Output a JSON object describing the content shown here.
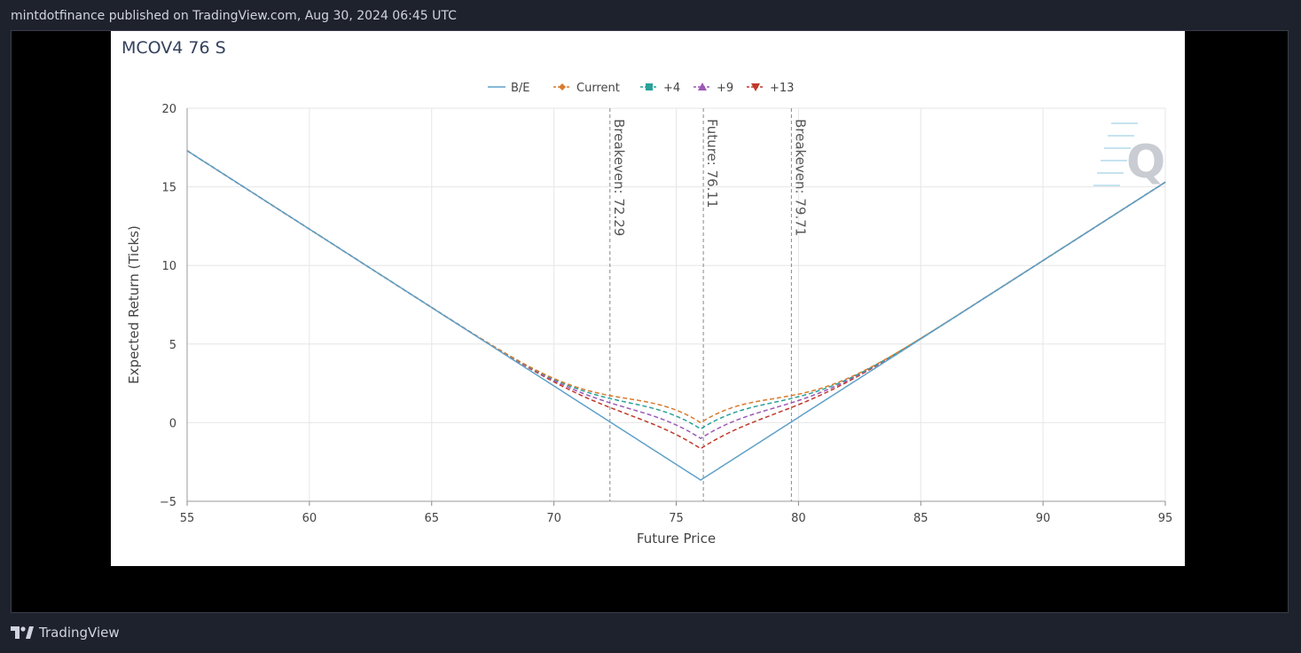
{
  "header": {
    "published_text": "mintdotfinance published on TradingView.com, Aug 30, 2024 06:45 UTC"
  },
  "footer": {
    "brand": "TradingView",
    "logo_icon": "tradingview-logo-icon"
  },
  "chart_data": {
    "type": "line",
    "title": "MCOV4 76 S",
    "xlabel": "Future Price",
    "ylabel": "Expected Return (Ticks)",
    "xlim": [
      55,
      95
    ],
    "ylim": [
      -5,
      20
    ],
    "x_ticks": [
      55,
      60,
      65,
      70,
      75,
      80,
      85,
      90,
      95
    ],
    "y_ticks": [
      20,
      15,
      10,
      5,
      0,
      -5
    ],
    "y_tick_labels": [
      "20",
      "15",
      "10",
      "5",
      "0",
      "−5"
    ],
    "grid": true,
    "legend_position": "top-center",
    "strike": 76,
    "series": [
      {
        "name": "B/E",
        "color": "#5fa0c8",
        "dash": false,
        "marker": "line",
        "min_value": -3.65
      },
      {
        "name": "Current",
        "color": "#d87a2c",
        "dash": true,
        "marker": "diamond",
        "min_value": 0.0
      },
      {
        "name": "+4",
        "color": "#2aa198",
        "dash": true,
        "marker": "square",
        "min_value": -0.4
      },
      {
        "name": "+9",
        "color": "#9b59b6",
        "dash": true,
        "marker": "triangle-up",
        "min_value": -1.0
      },
      {
        "name": "+13",
        "color": "#c0392b",
        "dash": true,
        "marker": "triangle-down",
        "min_value": -1.65
      }
    ],
    "vertical_lines": [
      {
        "x": 72.29,
        "label": "Breakeven: 72.29"
      },
      {
        "x": 76.11,
        "label": "Future: 76.11"
      },
      {
        "x": 79.71,
        "label": "Breakeven: 79.71"
      }
    ],
    "watermark": "Q"
  }
}
